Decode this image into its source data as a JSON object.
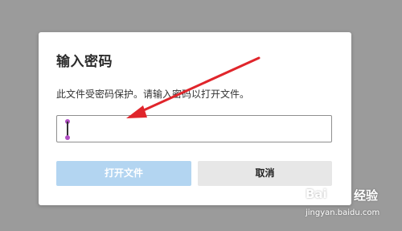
{
  "dialog": {
    "title": "输入密码",
    "message": "此文件受密码保护。请输入密码以打开文件。",
    "password_value": "",
    "open_button_label": "打开文件",
    "cancel_button_label": "取消"
  },
  "annotation": {
    "arrow_color": "#e0252b",
    "caret_marker_color": "#b14fc4"
  },
  "watermark": {
    "logo_text": "Bai",
    "site_name": "经验",
    "url": "jingyan.baidu.com"
  },
  "colors": {
    "overlay": "#9b9b9b",
    "dialog_bg": "#ffffff",
    "primary_disabled": "#b3d5f1",
    "secondary_button": "#e7e7e7"
  }
}
